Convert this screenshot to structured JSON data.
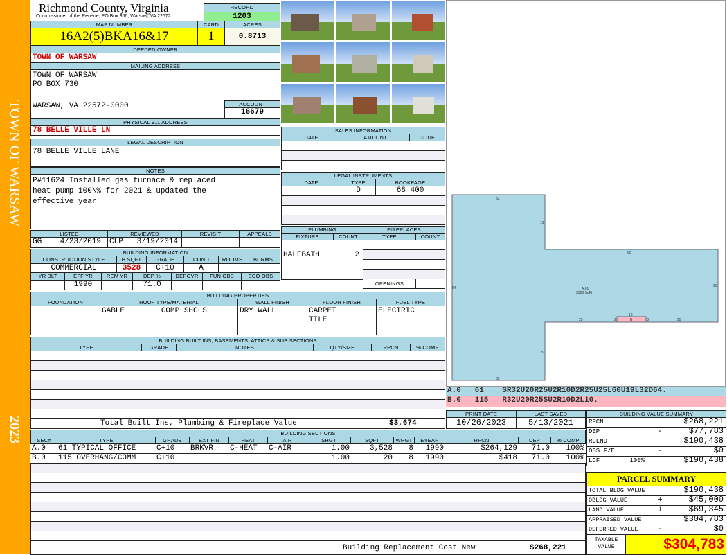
{
  "side": {
    "owner": "TOWN OF WARSAW",
    "year": "2023"
  },
  "header": {
    "county": "Richmond County, Virginia",
    "subtitle": "Commissioner of the Reueue, PO Box 366, Warsaw, VA 22572",
    "record_label": "RECORD",
    "record": "1203"
  },
  "parcel": {
    "map_label": "MAP NUMBER",
    "map": "16A2(5)BKA16&17",
    "card_label": "CARD",
    "card": "1",
    "acres_label": "ACRES",
    "acres": "0.8713"
  },
  "owner": {
    "label": "DEEDED OWNER",
    "value": "TOWN OF WARSAW"
  },
  "mailing": {
    "label": "MAILING ADDRESS",
    "line1": "TOWN OF WARSAW",
    "line2": "PO BOX 730",
    "line3": "WARSAW, VA 22572-0000",
    "account_label": "ACCOUNT",
    "account": "16679"
  },
  "physical": {
    "label": "PHYSICAL 911 ADDRESS",
    "value": "78 BELLE VILLE LN"
  },
  "legal": {
    "label": "LEGAL DESCRIPTION",
    "value": "78 BELLE VILLE LANE"
  },
  "notes": {
    "label": "NOTES",
    "line1": "P#11624 Installed gas furnace & replaced",
    "line2": "heat pump 100\\% for 2021 & updated the",
    "line3": "effective year"
  },
  "review": {
    "listed_label": "LISTED",
    "reviewed_label": "REVIEWED",
    "revisit_label": "REVISIT",
    "appeals_label": "APPEALS",
    "listed": "GG    4/23/2019",
    "reviewed": "CLP   3/19/2014"
  },
  "bldg_info": {
    "label": "BUILDING INFORMATION",
    "cols1": [
      "CONSTRUCTION STYLE",
      "H SQFT",
      "GRADE",
      "COND",
      "ROOMS",
      "BDRMS"
    ],
    "vals1": [
      "COMMERCIAL",
      "3528",
      "C+10",
      "A",
      "",
      ""
    ],
    "cols2": [
      "YR BLT",
      "EFF YR",
      "REM YR",
      "DEP %",
      "DEPOVR",
      "FUN OBS",
      "ECO OBS"
    ],
    "vals2": [
      "",
      "1990",
      "",
      "71.0",
      "",
      "",
      ""
    ]
  },
  "props": {
    "label": "BUILDING PROPERTIES",
    "cols": [
      "FOUNDATION",
      "ROOF TYPE/MATERIAL",
      "WALL FINISH",
      "FLOOR FINISH",
      "FUEL TYPE"
    ],
    "vals": [
      "",
      "GABLE        COMP SHGLS",
      "DRY WALL",
      "CARPET\nTILE",
      "ELECTRIC"
    ]
  },
  "builtins": {
    "label": "BUILDING BUILT INS, BASEMENTS, ATTICS & SUB SECTIONS",
    "cols": [
      "TYPE",
      "GRADE",
      "NOTES",
      "QTY/SIZE",
      "RPCN",
      "% COMP"
    ],
    "total_label": "Total Built Ins, Plumbing & Fireplace Value",
    "total": "$3,674"
  },
  "sales": {
    "label": "SALES INFORMATION",
    "cols": [
      "DATE",
      "AMOUNT",
      "CODE"
    ]
  },
  "instruments": {
    "label": "LEGAL INSTRUMENTS",
    "cols": [
      "DATE",
      "TYPE",
      "BOOKPAGE"
    ],
    "row": [
      "",
      "D",
      "68 400"
    ]
  },
  "plumbing": {
    "label": "PLUMBING",
    "cols": [
      "FIXTURE",
      "COUNT"
    ],
    "fixture": "HALFBATH",
    "count": "2"
  },
  "fireplaces": {
    "label": "FIREPLACES",
    "cols": [
      "TYPE",
      "COUNT"
    ],
    "openings": "OPENINGS"
  },
  "sections": {
    "label": "BUILDING SECTIONS",
    "cols": [
      "SEC#",
      "TYPE",
      "GRADE",
      "EXT FIN",
      "HEAT",
      "AIR",
      "SHGT",
      "SQFT",
      "WHGT",
      "EYEAR",
      "RPCN",
      "DEP",
      "% COMP"
    ],
    "rows": [
      [
        "A.0",
        "61 TYPICAL OFFICE",
        "C+10",
        "BRKVR",
        "C-HEAT",
        "C-AIR",
        "1.00",
        "3,528",
        "8",
        "1990",
        "$264,129",
        "71.0",
        "100%"
      ],
      [
        "B.0",
        "115 OVERHANG/COMM",
        "C+10",
        "",
        "",
        "",
        "1.00",
        "20",
        "8",
        "1990",
        "$418",
        "71.0",
        "100%"
      ]
    ],
    "replacement_label": "Building Replacement Cost New",
    "replacement": "$268,221"
  },
  "sketch": {
    "labels": {
      "a_top": "32",
      "a_right_upper": "19",
      "tee_top": "60",
      "left": "64",
      "right": "25",
      "center": "A.61",
      "center2": "3528 SqFt",
      "bot_left": "25",
      "bot_right": "25",
      "porch_top": "10",
      "porch_l": "2",
      "porch_r": "2",
      "porch": "B",
      "lower": "20",
      "bottom": "32"
    },
    "line_a": "A.0   61    SR32U20R25U2R10D2R25U25L60U19L32D64.",
    "line_b": "B.0   115   R32U20R25SU2R10D2L10."
  },
  "dates": {
    "print_label": "PRINT DATE",
    "print": "10/26/2023",
    "saved_label": "LAST SAVED",
    "saved": "5/13/2021"
  },
  "value_summary": {
    "label": "BUILDING VALUE SUMMARY",
    "rows": [
      [
        "RPCN",
        "",
        "$268,221"
      ],
      [
        "DEP",
        "-",
        "$77,783"
      ],
      [
        "RCLND",
        "",
        "$190,438"
      ],
      [
        "OBS F/E",
        "-",
        "$0"
      ],
      [
        "LCF        100%",
        "",
        "$190,438"
      ]
    ]
  },
  "parcel_summary": {
    "label": "PARCEL SUMMARY",
    "rows": [
      [
        "TOTAL BLDG VALUE",
        "",
        "$190,438"
      ],
      [
        "OBLDG VALUE",
        "+",
        "$45,000"
      ],
      [
        "LAND VALUE",
        "+",
        "$69,345"
      ],
      [
        "APPRAISED VALUE",
        "",
        "$304,783"
      ],
      [
        "DEFERRED VALUE",
        "-",
        "$0"
      ]
    ],
    "taxable_label": "TAXABLE\nVALUE",
    "taxable": "$304,783"
  },
  "colors": {
    "header": "#acd8e6",
    "strip": "#ffa500",
    "highlight": "#ffff00",
    "record": "#90ee90",
    "sketch_a": "#add8e6",
    "sketch_b": "#ffb6c1"
  }
}
